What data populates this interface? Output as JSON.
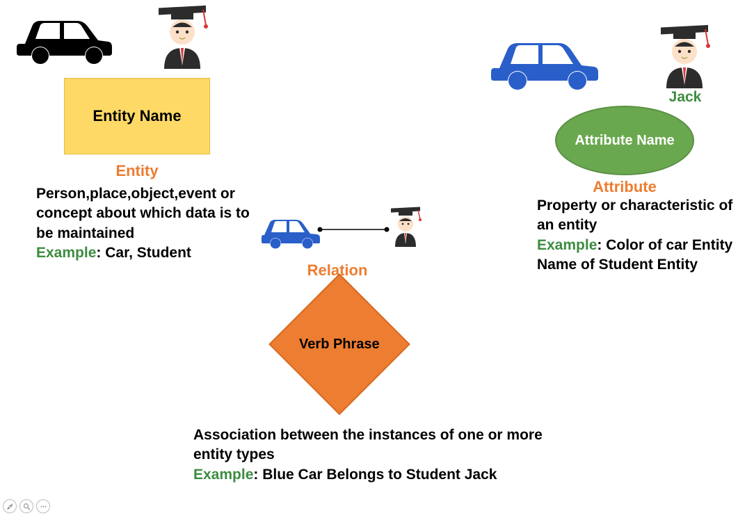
{
  "entity": {
    "shape_text": "Entity Name",
    "title": "Entity",
    "description": "Person,place,object,event or concept about which data is to be maintained",
    "example_label": "Example",
    "example_text": ": Car, Student"
  },
  "attribute": {
    "shape_text": "Attribute Name",
    "title": "Attribute",
    "description": "Property or characteristic of an entity",
    "example_label": "Example",
    "example_text": ": Color of car Entity Name of Student Entity",
    "student_name": "Jack"
  },
  "relation": {
    "shape_text": "Verb Phrase",
    "title": "Relation",
    "description": "Association between the instances of one or more entity types",
    "example_label": "Example",
    "example_text": ": Blue Car Belongs to Student Jack"
  },
  "icons": {
    "car_black": "car-icon",
    "car_blue": "car-icon",
    "student": "graduate-icon"
  }
}
